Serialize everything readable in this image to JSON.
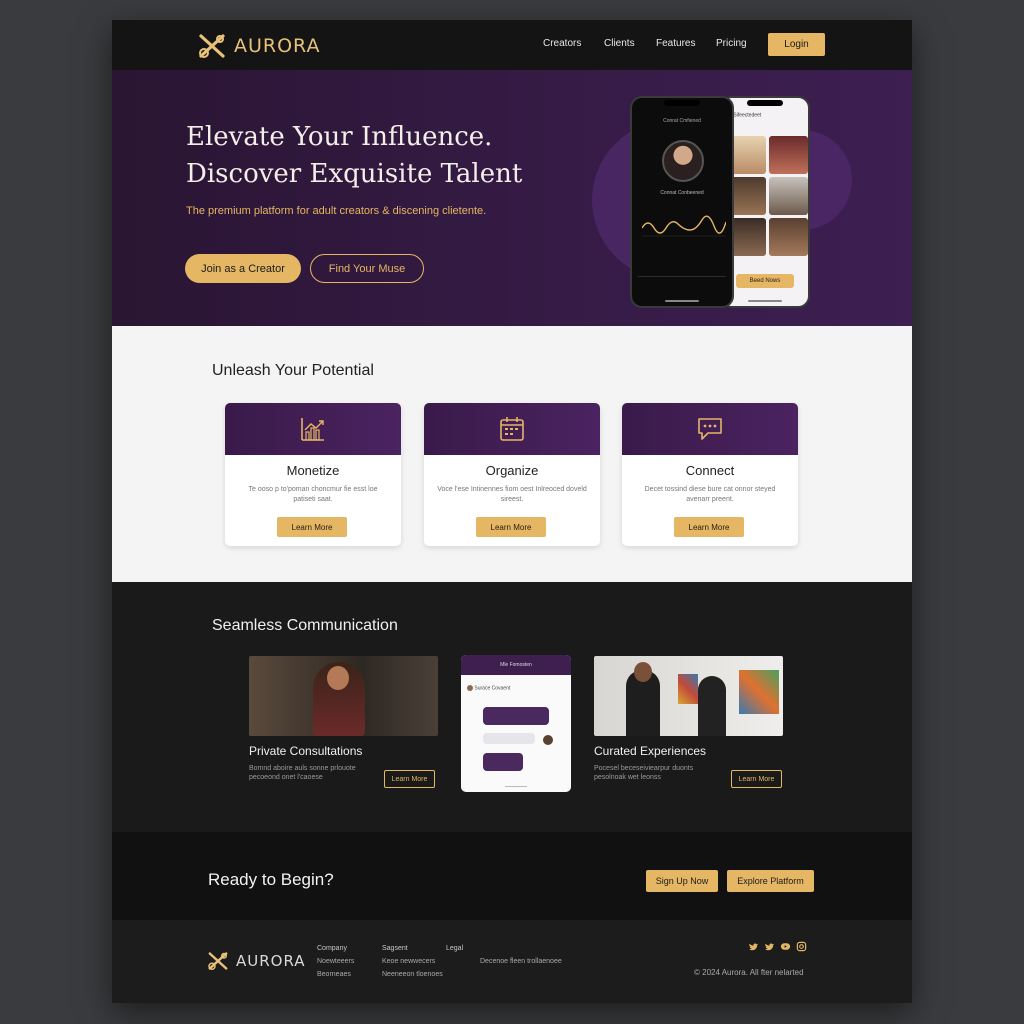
{
  "brand": {
    "name": "AURORA"
  },
  "nav": {
    "links": [
      "Creators",
      "Clients",
      "Features",
      "Pricing"
    ],
    "login_label": "Login"
  },
  "hero": {
    "headline_1": "Elevate Your Influence.",
    "headline_2": "Discover Exquisite Talent",
    "subtitle": "The premium platform for adult creators & discening clietente.",
    "primary_cta": "Join as a Creator",
    "secondary_cta": "Find Your Muse",
    "phone_left": {
      "title": "Conrat Cmfiened",
      "name": "Connat Conbeened"
    },
    "phone_right": {
      "header": "Sifeectedeet",
      "button": "Beed Nows"
    }
  },
  "features": {
    "heading": "Unleash Your Potential",
    "cards": [
      {
        "title": "Monetize",
        "text": "Te ooso p to'poman choncmur fie esst loe patiseti saat.",
        "button": "Learn More",
        "icon": "chart-growth-icon"
      },
      {
        "title": "Organize",
        "text": "Voce l'ese Intinennes fiom oest Inlreoced doveld sireest.",
        "button": "Learn More",
        "icon": "calendar-icon"
      },
      {
        "title": "Connect",
        "text": "Decet tossind diese bure cat onnor steyed avenarr preent.",
        "button": "Learn More",
        "icon": "chat-bubble-icon"
      }
    ]
  },
  "communication": {
    "heading": "Seamless Communication",
    "card_left": {
      "title": "Private Consultations",
      "text": "Bomnd aboire auls sonne prlouote pecoeond onet l'caoese",
      "button": "Learn More"
    },
    "chat_header": "Mle Fomosten",
    "chat_user": "Surace Covaent",
    "card_right": {
      "title": "Curated Experiences",
      "text": "Pocesel beceseiviearpur duonts pesolnoak wet leonss",
      "button": "Learn More"
    }
  },
  "cta": {
    "heading": "Ready to Begin?",
    "primary": "Sign Up Now",
    "secondary": "Explore Platform"
  },
  "footer": {
    "columns": [
      {
        "heading": "Company",
        "items": [
          "Noewteeers",
          "Beorneaes"
        ]
      },
      {
        "heading": "Sagsent",
        "items": [
          "Keoe newwecers",
          "Neeneeon tloenoes"
        ]
      },
      {
        "heading": "Legal",
        "items": [
          "Decenoe fleen trollaenoee"
        ]
      }
    ],
    "social_icons": [
      "twitter-icon",
      "twitter-icon",
      "youtube-icon",
      "instagram-icon"
    ],
    "copyright": "© 2024 Aurora. All fter nelarted"
  },
  "colors": {
    "gold": "#e5b663",
    "purple": "#3d1f52",
    "dark": "#151516"
  }
}
